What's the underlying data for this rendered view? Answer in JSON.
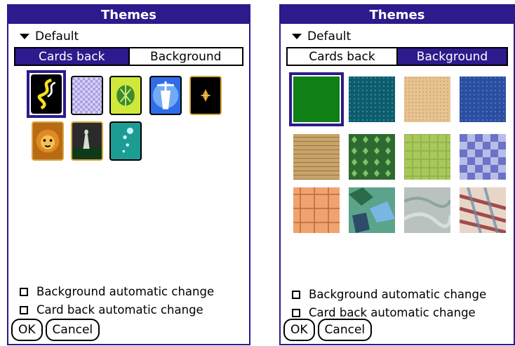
{
  "left_dialog": {
    "title": "Themes",
    "dropdown_value": "Default",
    "tabs": [
      {
        "label": "Cards back",
        "active": true
      },
      {
        "label": "Background",
        "active": false
      }
    ],
    "checkbox_1": "Background automatic change",
    "checkbox_2": "Card back automatic change",
    "ok": "OK",
    "cancel": "Cancel"
  },
  "right_dialog": {
    "title": "Themes",
    "dropdown_value": "Default",
    "tabs": [
      {
        "label": "Cards back",
        "active": false
      },
      {
        "label": "Background",
        "active": true
      }
    ],
    "checkbox_1": "Background automatic change",
    "checkbox_2": "Card back automatic change",
    "ok": "OK",
    "cancel": "Cancel"
  },
  "colors": {
    "accent": "#2d1a8c",
    "tile_gold": "#d7a63a"
  }
}
